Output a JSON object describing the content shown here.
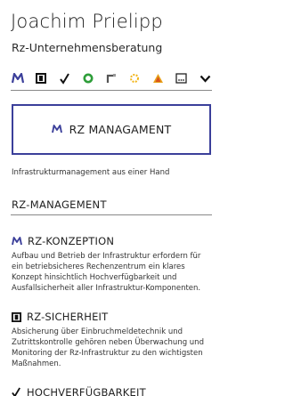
{
  "header": {
    "title": "Joachim Prielipp",
    "subtitle": "Rz-Unternehmensberatung"
  },
  "iconbar": {
    "icons": [
      "m-logo-icon",
      "square-icon",
      "check-icon",
      "ring-icon",
      "corner-icon",
      "sun-icon",
      "warning-triangle-icon",
      "ellipsis-box-icon",
      "chevron-down-icon"
    ],
    "colors": {
      "brand": "#3b3f9a",
      "ring": "#2e9e3a",
      "sun": "#f2b51a",
      "warning": "#e8a21a"
    }
  },
  "feature": {
    "label": "RZ MANAGAMENT"
  },
  "tagline": "Infrastrukturmanagement aus einer Hand",
  "section": {
    "heading": "RZ-MANAGEMENT"
  },
  "items": [
    {
      "title": "RZ-KONZEPTION",
      "icon": "m-logo-icon",
      "description": "Aufbau und Betrieb der Infrastruktur erfordern für ein betriebsicheres Rechenzentrum ein klares Konzept hinsichtlich Hochverfügbarkeit und Ausfallsicherheit aller Infrastruktur-Komponenten."
    },
    {
      "title": "RZ-SICHERHEIT",
      "icon": "square-icon",
      "description": "Absicherung über Einbruchmeldetechnik und Zutrittskontrolle gehören neben Überwachung und Monitoring der Rz-Infrastruktur zu den wichtigsten Maßnahmen."
    },
    {
      "title": "HOCHVERFÜGBARKEIT",
      "icon": "check-icon"
    }
  ]
}
